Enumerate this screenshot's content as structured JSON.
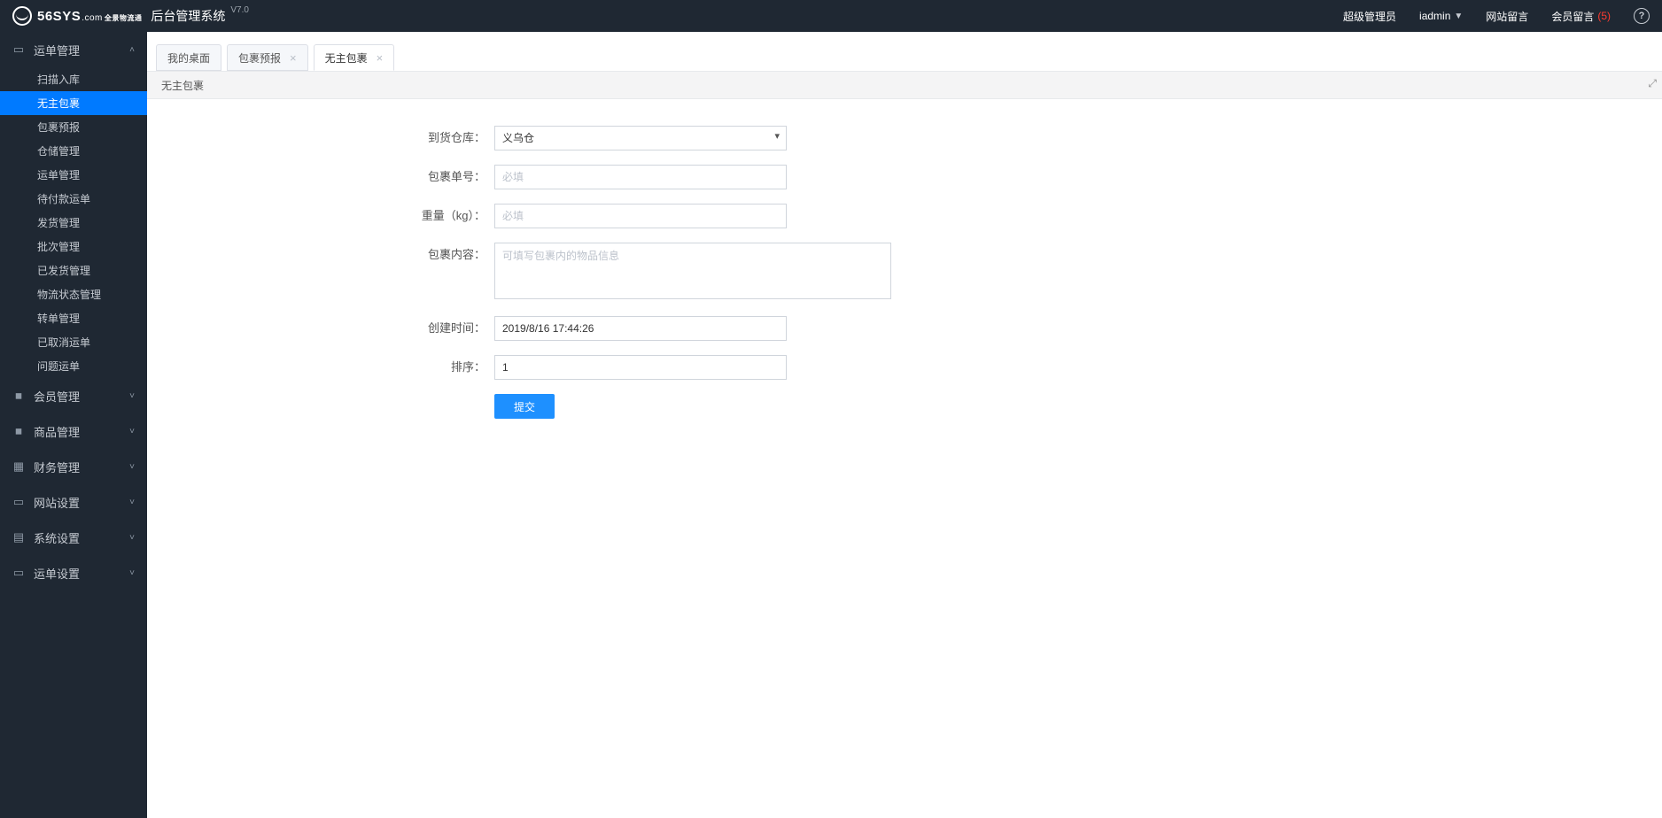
{
  "header": {
    "brand_main": "56SYS",
    "brand_tld": ".com",
    "brand_sub": "全景物流通",
    "system_title": "后台管理系统",
    "version": "V7.0",
    "role_label": "超级管理员",
    "user_name": "iadmin",
    "site_msg_label": "网站留言",
    "member_msg_label": "会员留言",
    "member_msg_count": "(5)"
  },
  "sidebar": {
    "groups": [
      {
        "label": "运单管理",
        "expanded": true,
        "icon": "i-doc",
        "items": [
          {
            "label": "扫描入库"
          },
          {
            "label": "无主包裹",
            "active": true
          },
          {
            "label": "包裹预报"
          },
          {
            "label": "仓储管理"
          },
          {
            "label": "运单管理"
          },
          {
            "label": "待付款运单"
          },
          {
            "label": "发货管理"
          },
          {
            "label": "批次管理"
          },
          {
            "label": "已发货管理"
          },
          {
            "label": "物流状态管理"
          },
          {
            "label": "转单管理"
          },
          {
            "label": "已取消运单"
          },
          {
            "label": "问题运单"
          }
        ]
      },
      {
        "label": "会员管理",
        "expanded": false,
        "icon": "i-user"
      },
      {
        "label": "商品管理",
        "expanded": false,
        "icon": "i-user"
      },
      {
        "label": "财务管理",
        "expanded": false,
        "icon": "i-gift"
      },
      {
        "label": "网站设置",
        "expanded": false,
        "icon": "i-screen"
      },
      {
        "label": "系统设置",
        "expanded": false,
        "icon": "i-gear"
      },
      {
        "label": "运单设置",
        "expanded": false,
        "icon": "i-doc"
      }
    ]
  },
  "tabs": [
    {
      "label": "我的桌面",
      "closable": false,
      "active": false
    },
    {
      "label": "包裹预报",
      "closable": true,
      "active": false
    },
    {
      "label": "无主包裹",
      "closable": true,
      "active": true
    }
  ],
  "page_title": "无主包裹",
  "form": {
    "warehouse_label": "到货仓库：",
    "warehouse_value": "义乌仓",
    "package_no_label": "包裹单号：",
    "package_no_placeholder": "必填",
    "weight_label": "重量（kg）：",
    "weight_placeholder": "必填",
    "content_label": "包裹内容：",
    "content_placeholder": "可填写包裹内的物品信息",
    "created_label": "创建时间：",
    "created_value": "2019/8/16 17:44:26",
    "sort_label": "排序：",
    "sort_value": "1",
    "submit_label": "提交"
  }
}
